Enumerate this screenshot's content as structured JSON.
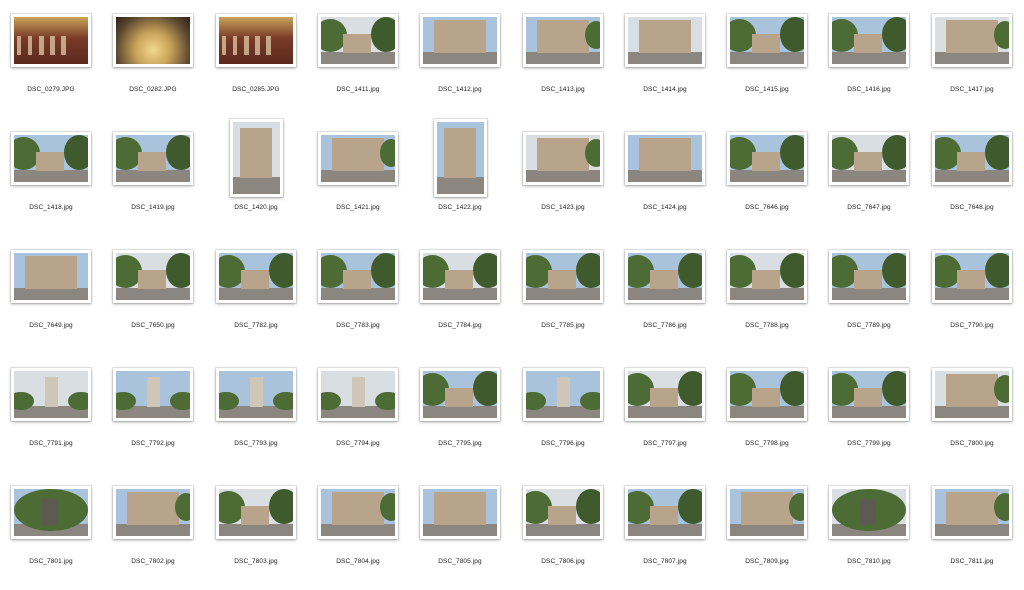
{
  "files": [
    {
      "name": "DSC_0279.JPG",
      "scene": "concert-hall"
    },
    {
      "name": "DSC_0282.JPG",
      "scene": "stained-glass"
    },
    {
      "name": "DSC_0285.JPG",
      "scene": "concert-hall"
    },
    {
      "name": "DSC_1411.jpg",
      "scene": "avenue"
    },
    {
      "name": "DSC_1412.jpg",
      "scene": "building"
    },
    {
      "name": "DSC_1413.jpg",
      "scene": "building"
    },
    {
      "name": "DSC_1414.jpg",
      "scene": "building"
    },
    {
      "name": "DSC_1415.jpg",
      "scene": "avenue"
    },
    {
      "name": "DSC_1416.jpg",
      "scene": "street"
    },
    {
      "name": "DSC_1417.jpg",
      "scene": "facade"
    },
    {
      "name": "DSC_1418.jpg",
      "scene": "street"
    },
    {
      "name": "DSC_1419.jpg",
      "scene": "avenue"
    },
    {
      "name": "DSC_1420.jpg",
      "scene": "facade",
      "orientation": "portrait"
    },
    {
      "name": "DSC_1421.jpg",
      "scene": "facade"
    },
    {
      "name": "DSC_1422.jpg",
      "scene": "facade",
      "orientation": "portrait"
    },
    {
      "name": "DSC_1423.jpg",
      "scene": "facade"
    },
    {
      "name": "DSC_1424.jpg",
      "scene": "building"
    },
    {
      "name": "DSC_7646.jpg",
      "scene": "avenue"
    },
    {
      "name": "DSC_7647.jpg",
      "scene": "street"
    },
    {
      "name": "DSC_7648.jpg",
      "scene": "street"
    },
    {
      "name": "DSC_7649.jpg",
      "scene": "building"
    },
    {
      "name": "DSC_7650.jpg",
      "scene": "street"
    },
    {
      "name": "DSC_7782.jpg",
      "scene": "plaza"
    },
    {
      "name": "DSC_7783.jpg",
      "scene": "plaza"
    },
    {
      "name": "DSC_7784.jpg",
      "scene": "plaza"
    },
    {
      "name": "DSC_7785.jpg",
      "scene": "avenue"
    },
    {
      "name": "DSC_7786.jpg",
      "scene": "plaza"
    },
    {
      "name": "DSC_7788.jpg",
      "scene": "plaza"
    },
    {
      "name": "DSC_7789.jpg",
      "scene": "plaza"
    },
    {
      "name": "DSC_7790.jpg",
      "scene": "plaza"
    },
    {
      "name": "DSC_7791.jpg",
      "scene": "monument"
    },
    {
      "name": "DSC_7792.jpg",
      "scene": "monument"
    },
    {
      "name": "DSC_7793.jpg",
      "scene": "monument"
    },
    {
      "name": "DSC_7794.jpg",
      "scene": "monument"
    },
    {
      "name": "DSC_7795.jpg",
      "scene": "plaza"
    },
    {
      "name": "DSC_7796.jpg",
      "scene": "monument"
    },
    {
      "name": "DSC_7797.jpg",
      "scene": "plaza"
    },
    {
      "name": "DSC_7798.jpg",
      "scene": "plaza"
    },
    {
      "name": "DSC_7799.jpg",
      "scene": "plaza"
    },
    {
      "name": "DSC_7800.jpg",
      "scene": "building"
    },
    {
      "name": "DSC_7801.jpg",
      "scene": "statue"
    },
    {
      "name": "DSC_7802.jpg",
      "scene": "building"
    },
    {
      "name": "DSC_7803.jpg",
      "scene": "plaza"
    },
    {
      "name": "DSC_7804.jpg",
      "scene": "building"
    },
    {
      "name": "DSC_7805.jpg",
      "scene": "building"
    },
    {
      "name": "DSC_7806.jpg",
      "scene": "plaza"
    },
    {
      "name": "DSC_7807.jpg",
      "scene": "plaza"
    },
    {
      "name": "DSC_7809.jpg",
      "scene": "building"
    },
    {
      "name": "DSC_7810.jpg",
      "scene": "statue"
    },
    {
      "name": "DSC_7811.jpg",
      "scene": "building"
    }
  ],
  "colors": {
    "background": "#ffffff",
    "label": "#1a1a1a",
    "sky": "#a9c3dc",
    "sky_cloudy": "#d9dee3",
    "tree": "#4d6b35",
    "stone": "#b8a48a",
    "pavement": "#8b8680",
    "interior": "#7a3a28",
    "glass": "#c9a45a"
  }
}
